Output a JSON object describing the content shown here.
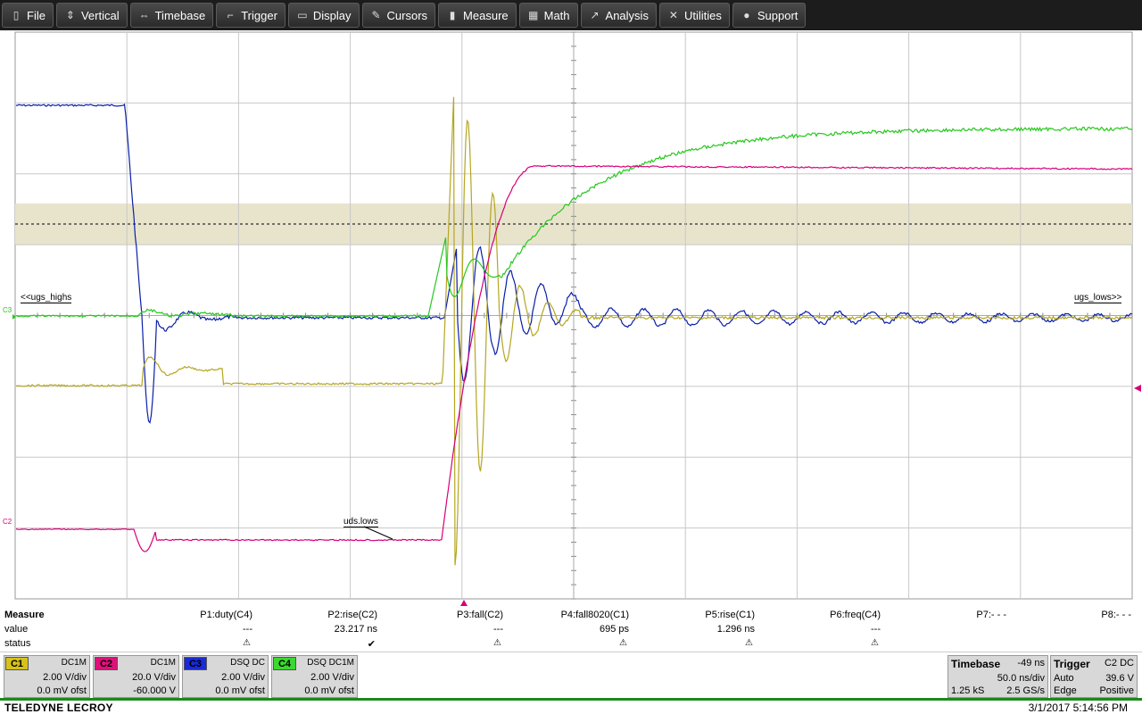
{
  "menu": [
    {
      "label": "File",
      "icon": "file-icon",
      "glyph": "▯"
    },
    {
      "label": "Vertical",
      "icon": "vertical-arrows-icon",
      "glyph": "⇕"
    },
    {
      "label": "Timebase",
      "icon": "horizontal-arrows-icon",
      "glyph": "⇔"
    },
    {
      "label": "Trigger",
      "icon": "trigger-icon",
      "glyph": "⌐"
    },
    {
      "label": "Display",
      "icon": "display-icon",
      "glyph": "▭"
    },
    {
      "label": "Cursors",
      "icon": "cursors-icon",
      "glyph": "✎"
    },
    {
      "label": "Measure",
      "icon": "measure-icon",
      "glyph": "▮"
    },
    {
      "label": "Math",
      "icon": "math-icon",
      "glyph": "▦"
    },
    {
      "label": "Analysis",
      "icon": "analysis-icon",
      "glyph": "↗"
    },
    {
      "label": "Utilities",
      "icon": "utilities-icon",
      "glyph": "✕"
    },
    {
      "label": "Support",
      "icon": "support-icon",
      "glyph": "●"
    }
  ],
  "annotations": {
    "ugs_highs": "<<ugs_highs",
    "ugs_lows": "ugs_lows>>",
    "uds_lows": "uds.lows",
    "c3_marker": "C3",
    "c2_marker": "C2"
  },
  "colors": {
    "c1": "#b5a620",
    "c2": "#d6007a",
    "c3": "#0a1fa8",
    "c4": "#27c81e",
    "grid": "#c8c8c8",
    "band": "#e8e4cc"
  },
  "measure": {
    "title": "Measure",
    "row_value": "value",
    "row_status": "status",
    "params": [
      {
        "name": "P1:duty(C4)",
        "value": "---",
        "status": "warn"
      },
      {
        "name": "P2:rise(C2)",
        "value": "23.217 ns",
        "status": "ok"
      },
      {
        "name": "P3:fall(C2)",
        "value": "---",
        "status": "warn"
      },
      {
        "name": "P4:fall8020(C1)",
        "value": "695 ps",
        "status": "warn"
      },
      {
        "name": "P5:rise(C1)",
        "value": "1.296 ns",
        "status": "warn"
      },
      {
        "name": "P6:freq(C4)",
        "value": "---",
        "status": "warn"
      },
      {
        "name": "P7:- - -",
        "value": "",
        "status": ""
      },
      {
        "name": "P8:- - -",
        "value": "",
        "status": ""
      }
    ]
  },
  "channels": [
    {
      "tag": "C1",
      "coupling": "DC1M",
      "vdiv": "2.00 V/div",
      "offset": "0.0 mV ofst",
      "color": "#d6c21a"
    },
    {
      "tag": "C2",
      "coupling": "DC1M",
      "vdiv": "20.0 V/div",
      "offset": "-60.000 V",
      "color": "#e0107a"
    },
    {
      "tag": "C3",
      "coupling": "DSQ  DC",
      "vdiv": "2.00 V/div",
      "offset": "0.0 mV ofst",
      "color": "#1a2ad8"
    },
    {
      "tag": "C4",
      "coupling": "DSQ  DC1M",
      "vdiv": "2.00 V/div",
      "offset": "0.0 mV ofst",
      "color": "#3ad830"
    }
  ],
  "timebase": {
    "label": "Timebase",
    "delay": "-49 ns",
    "tdiv": "50.0 ns/div",
    "samples": "1.25 kS",
    "rate": "2.5 GS/s"
  },
  "trigger": {
    "label": "Trigger",
    "source": "C2  DC",
    "mode": "Auto",
    "level": "39.6 V",
    "type": "Edge",
    "slope": "Positive"
  },
  "footer": {
    "brand": "TELEDYNE LECROY",
    "datetime": "3/1/2017 5:14:56 PM"
  }
}
